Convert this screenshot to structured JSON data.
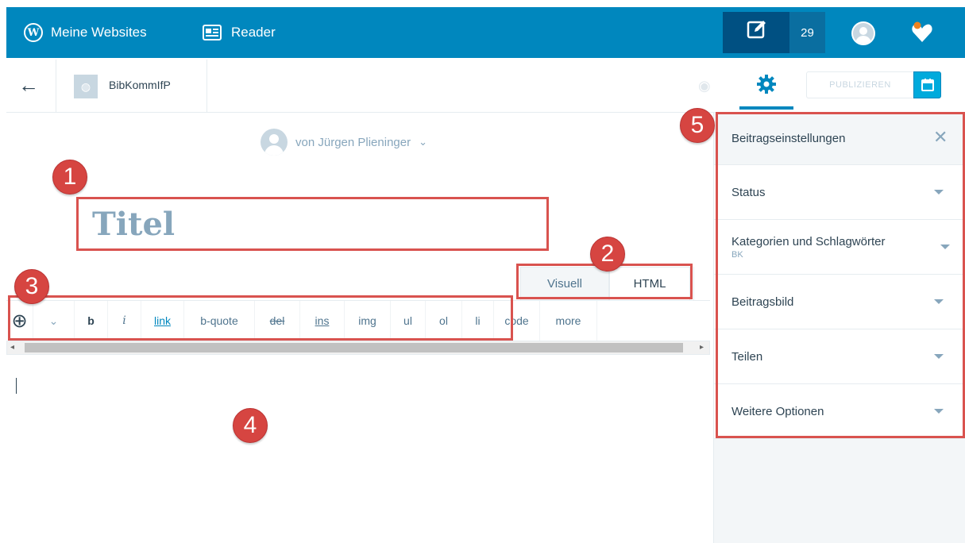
{
  "topbar": {
    "my_sites": "Meine Websites",
    "reader": "Reader",
    "notification_count": "29",
    "icons": [
      "wordpress-logo-icon",
      "reader-icon",
      "write-icon",
      "avatar",
      "notifications-icon"
    ]
  },
  "secbar": {
    "site_name": "BibKommIfP",
    "publish_label": "PUBLIZIEREN"
  },
  "editor": {
    "author": "von Jürgen Plieninger",
    "title_placeholder": "Titel",
    "tabs": [
      {
        "label": "Visuell"
      },
      {
        "label": "HTML"
      }
    ],
    "toolbar": [
      {
        "label": "b"
      },
      {
        "label": "i"
      },
      {
        "label": "link"
      },
      {
        "label": "b-quote"
      },
      {
        "label": "del"
      },
      {
        "label": "ins"
      },
      {
        "label": "img"
      },
      {
        "label": "ul"
      },
      {
        "label": "ol"
      },
      {
        "label": "li"
      },
      {
        "label": "code"
      },
      {
        "label": "more"
      }
    ]
  },
  "sidebar": {
    "title": "Beitragseinstellungen",
    "sections": [
      {
        "label": "Status"
      },
      {
        "label": "Kategorien und Schlagwörter",
        "sub": "BK"
      },
      {
        "label": "Beitragsbild"
      },
      {
        "label": "Teilen"
      },
      {
        "label": "Weitere Optionen"
      }
    ]
  },
  "callouts": [
    "1",
    "2",
    "3",
    "4",
    "5"
  ],
  "colors": {
    "brand": "#0087be",
    "callout": "#d64541",
    "accent": "#00aadc"
  }
}
